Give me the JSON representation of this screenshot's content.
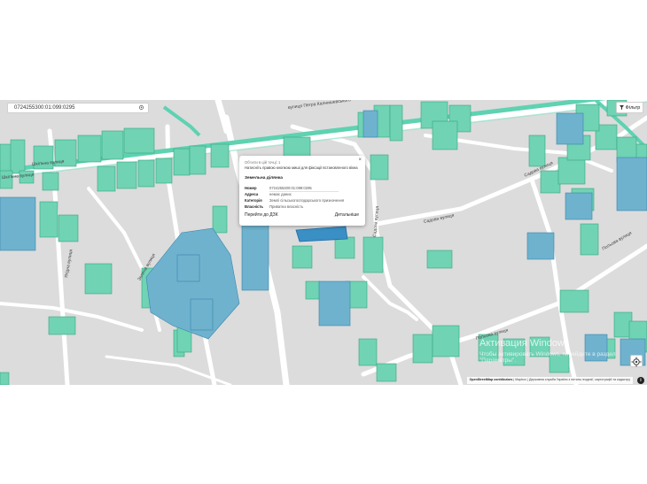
{
  "search": {
    "value": "0724255300:01:099:0295"
  },
  "filter": {
    "label": "Фільтр",
    "icon": "funnel-icon"
  },
  "streets": {
    "s1": "вулиця Петра Калнишевського",
    "s2": "Шкільна вулиця",
    "s3": "Зелена вулиця",
    "s4": "Ягідна вулиця",
    "s5": "Садова вулиця",
    "s6": "Садова вулиця",
    "s7": "Садова вулиця",
    "s8": "Польова вулиця",
    "s9": "Польова вулиця",
    "s10": "Шкільна вулиця"
  },
  "popup": {
    "count": "Об'єкти в цій точці: 1",
    "note": "Натисніть правою кнопкою миші для фіксації встановленого вікна",
    "section": "Земельна ділянка",
    "rows": [
      {
        "key": "Номер",
        "value": "0724255300:01:099:0295"
      },
      {
        "key": "Адреса",
        "value": "немає даних"
      },
      {
        "key": "Категорія",
        "value": "Землі сільськогосподарського призначення"
      },
      {
        "key": "Власність",
        "value": "Приватна власність"
      }
    ],
    "btn_dzk": "Перейти до ДЗК",
    "btn_details": "Детальніше",
    "close": "×"
  },
  "attribution": {
    "osm": "OpenStreetMap contributors",
    "rest": " | Mapbox | Державна служба України з питань геодезії, картографії та кадастру"
  },
  "watermark": {
    "line1": "Активация Windows",
    "line2": "Чтобы активировать Windows, перейдите в раздел \"Параметры\"."
  },
  "colors": {
    "map_bg": "#dcdcdc",
    "road": "#ffffff",
    "main_road": "#5ed2b1",
    "parcel_green": "#6fd3b4",
    "parcel_blue": "#6fb2ce",
    "selected_parcel": "#3a8fc4"
  }
}
